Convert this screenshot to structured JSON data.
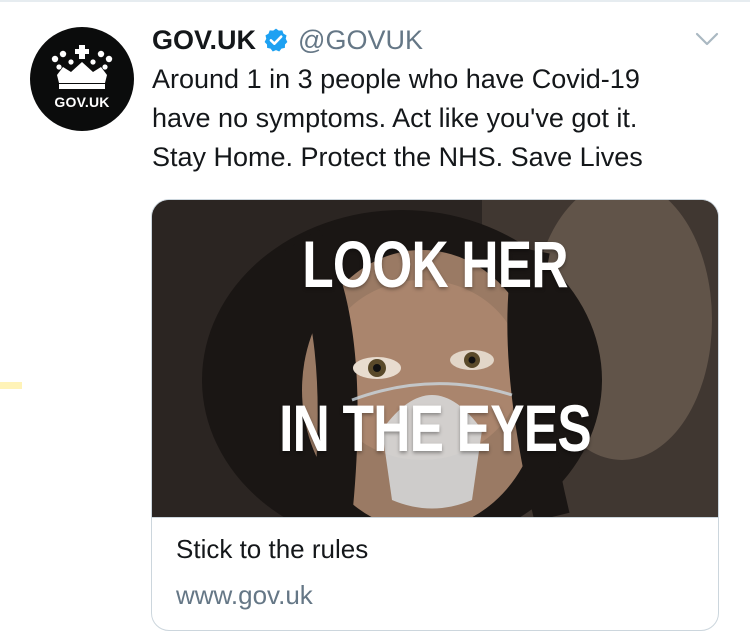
{
  "tweet": {
    "author": {
      "display_name": "GOV.UK",
      "handle": "@GOVUK",
      "verified": true,
      "avatar_text": "GOV.UK",
      "avatar_icon": "crown-icon"
    },
    "text_lines": [
      "Around 1 in 3 people who have Covid-19",
      "have no symptoms. Act like you've got it.",
      "Stay Home. Protect the NHS. Save Lives"
    ],
    "menu_icon": "chevron-down-icon",
    "card": {
      "image_text_top": "LOOK HER",
      "image_text_bottom": "IN THE EYES",
      "title": "Stick to the rules",
      "url": "www.gov.uk"
    }
  },
  "colors": {
    "text_primary": "#14171a",
    "text_secondary": "#657786",
    "verified_blue": "#1da1f2",
    "avatar_bg": "#0b0c0c",
    "card_border": "#ccd6dd"
  }
}
